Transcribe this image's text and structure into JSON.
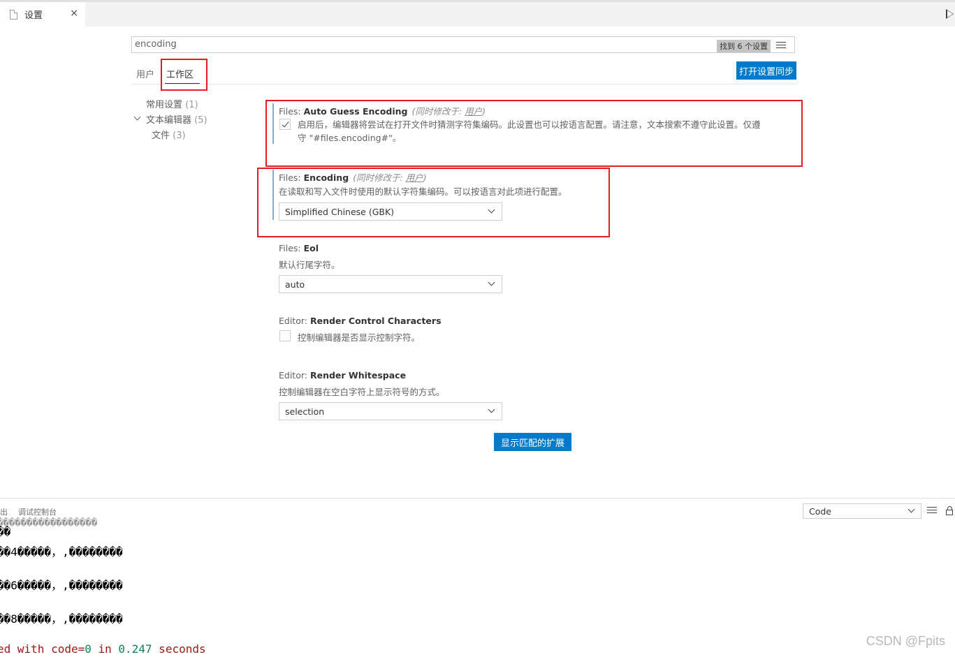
{
  "tab": {
    "title": "设置",
    "close": "×"
  },
  "search": {
    "value": "encoding",
    "count": "找到 6 个设置"
  },
  "scopes": {
    "user": "用户",
    "workspace": "工作区",
    "sync_button": "打开设置同步"
  },
  "toc": {
    "common": {
      "label": "常用设置",
      "count": "(1)"
    },
    "text_editor": {
      "label": "文本编辑器",
      "count": "(5)"
    },
    "files": {
      "label": "文件",
      "count": "(3)"
    }
  },
  "settings": {
    "auto_guess": {
      "category": "Files: ",
      "name": "Auto Guess Encoding",
      "modified_prefix": "(同时修改于: ",
      "modified_link": "用户",
      "modified_suffix": ")",
      "checked": true,
      "description_line1": "启用后，编辑器将尝试在打开文件时猜测字符集编码。此设置也可以按语言配置。请注意，文本搜索不遵守此设置。仅遵",
      "description_line2": "守 \"#files.encoding#\"。"
    },
    "encoding": {
      "category": "Files: ",
      "name": "Encoding",
      "modified_prefix": "(同时修改于: ",
      "modified_link": "用户",
      "modified_suffix": ")",
      "description": "在读取和写入文件时使用的默认字符集编码。可以按语言对此项进行配置。",
      "value": "Simplified Chinese (GBK)"
    },
    "eol": {
      "category": "Files: ",
      "name": "Eol",
      "description": "默认行尾字符。",
      "value": "auto"
    },
    "render_control": {
      "category": "Editor: ",
      "name": "Render Control Characters",
      "description": "控制编辑器是否显示控制字符。",
      "checked": false
    },
    "render_whitespace": {
      "category": "Editor: ",
      "name": "Render Whitespace",
      "description": "控制编辑器在空白字符上显示符号的方式。",
      "value": "selection"
    }
  },
  "extensions_button": "显示匹配的扩展",
  "panel": {
    "tab_fragment": "出",
    "debug_console_tab": "调试控制台",
    "output_source": "Code"
  },
  "output": {
    "faded_line": "�����������������",
    "line1": "��",
    "line2": "��4�����，‚��������",
    "line3": "��6�����，‚��������",
    "line4": "��8�����，‚��������",
    "done_prefix": "ed with code=",
    "done_code": "0",
    "done_mid": " in ",
    "done_time": "0.247",
    "done_suffix": " seconds"
  },
  "watermark": "CSDN @Fpits"
}
